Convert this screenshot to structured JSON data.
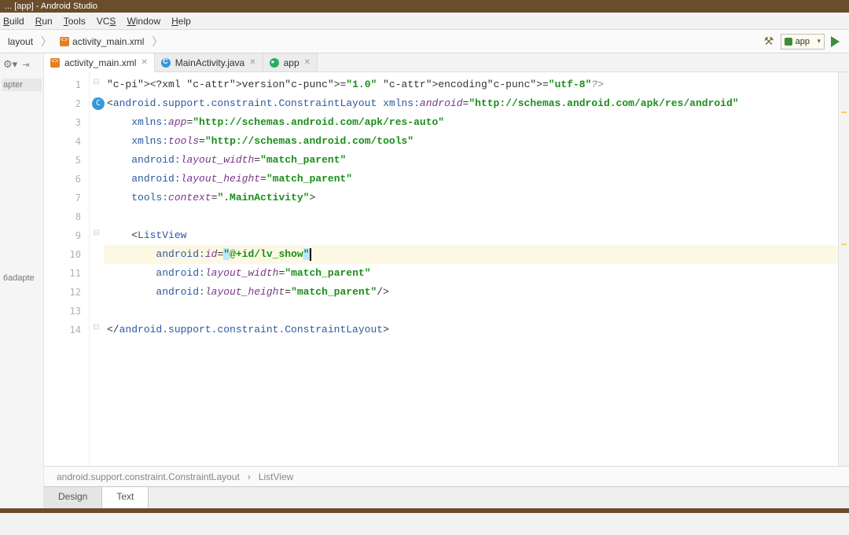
{
  "title": "... [app] - Android Studio",
  "menu": {
    "items": [
      "Build",
      "Run",
      "Tools",
      "VCS",
      "Window",
      "Help"
    ]
  },
  "breadcrumbs": [
    "layout",
    "activity_main.xml"
  ],
  "run_config": {
    "selected": "app"
  },
  "left_panel": {
    "items": [
      "apter",
      "6adapte"
    ],
    "selected_index": 0
  },
  "tabs": [
    {
      "label": "activity_main.xml",
      "icon": "xml",
      "active": true
    },
    {
      "label": "MainActivity.java",
      "icon": "java",
      "active": false
    },
    {
      "label": "app",
      "icon": "app",
      "active": false
    }
  ],
  "editor": {
    "highlight_line": 10,
    "author_badge_line": 2,
    "author_badge_text": "C",
    "lines": [
      {
        "n": 1,
        "t": "<?xml version=\"1.0\" encoding=\"utf-8\"?>"
      },
      {
        "n": 2,
        "t": "<android.support.constraint.ConstraintLayout xmlns:android=\"http://schemas.android.com/apk/res/android\""
      },
      {
        "n": 3,
        "t": "    xmlns:app=\"http://schemas.android.com/apk/res-auto\""
      },
      {
        "n": 4,
        "t": "    xmlns:tools=\"http://schemas.android.com/tools\""
      },
      {
        "n": 5,
        "t": "    android:layout_width=\"match_parent\""
      },
      {
        "n": 6,
        "t": "    android:layout_height=\"match_parent\""
      },
      {
        "n": 7,
        "t": "    tools:context=\".MainActivity\">"
      },
      {
        "n": 8,
        "t": ""
      },
      {
        "n": 9,
        "t": "    <ListView"
      },
      {
        "n": 10,
        "t": "        android:id=\"@+id/lv_show\""
      },
      {
        "n": 11,
        "t": "        android:layout_width=\"match_parent\""
      },
      {
        "n": 12,
        "t": "        android:layout_height=\"match_parent\"/>"
      },
      {
        "n": 13,
        "t": ""
      },
      {
        "n": 14,
        "t": "</android.support.constraint.ConstraintLayout>"
      }
    ]
  },
  "crumb_path": [
    "android.support.constraint.ConstraintLayout",
    "ListView"
  ],
  "bottom_tabs": [
    {
      "label": "Design",
      "active": false
    },
    {
      "label": "Text",
      "active": true
    }
  ]
}
